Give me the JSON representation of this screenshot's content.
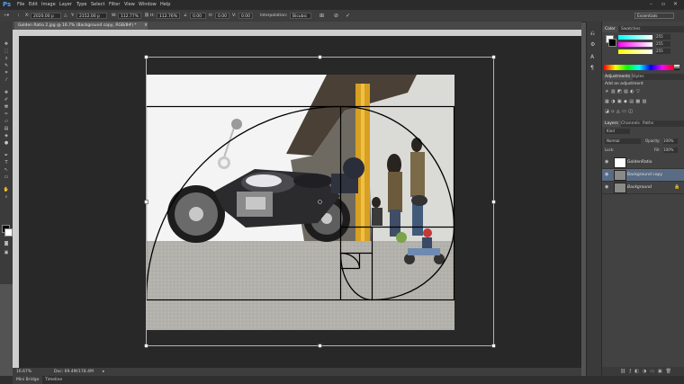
{
  "app": {
    "logo": "Ps"
  },
  "menu": [
    "File",
    "Edit",
    "Image",
    "Layer",
    "Type",
    "Select",
    "Filter",
    "View",
    "Window",
    "Help"
  ],
  "workspace": "Essentials",
  "options": {
    "x": "2020.00 p",
    "y": "2152.00 p",
    "w": "112.77%",
    "h": "112.76%",
    "angle": "0.00",
    "h_skew": "0.00",
    "v_skew": "0.00",
    "interpolation_label": "Interpolation:",
    "interpolation_value": "Bicubic"
  },
  "document": {
    "tab_title": "Golden Ratio 2.jpg @ 16.7% (Background copy, RGB/8#) *"
  },
  "status": {
    "zoom": "16.67%",
    "doc": "Doc: 69.4M/178.4M"
  },
  "bottom_tabs": [
    "Mini Bridge",
    "Timeline"
  ],
  "panels": {
    "color_tabs": [
      "Color",
      "Swatches"
    ],
    "color_fields": [
      "255",
      "255",
      "255"
    ],
    "adjust_tabs": [
      "Adjustments",
      "Styles"
    ],
    "adjust_title": "Add an adjustment",
    "layers_tabs": [
      "Layers",
      "Channels",
      "Paths"
    ],
    "kind": "Kind",
    "blend_mode": "Normal",
    "opacity_label": "Opacity:",
    "opacity_value": "100%",
    "lock_label": "Lock:",
    "fill_label": "Fill:",
    "fill_value": "100%",
    "layers": [
      {
        "name": "GoldenRatio"
      },
      {
        "name": "Background copy"
      },
      {
        "name": "Background"
      }
    ]
  },
  "colors": {
    "accent": "#4fa0e6",
    "selected_layer": "#5a6b84"
  }
}
